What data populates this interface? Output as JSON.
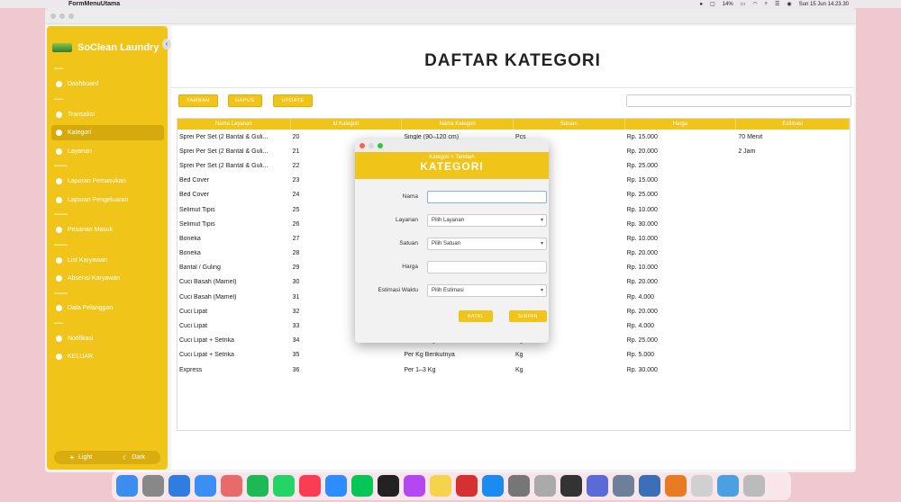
{
  "menubar": {
    "app_name": "FormMenuUtama",
    "battery": "14%",
    "datetime": "Sun 15 Jun  14.23.30"
  },
  "sidebar": {
    "brand": "SoClean Laundry",
    "items": [
      {
        "label": "Dashboard",
        "icon": "dashboard-icon"
      },
      {
        "label": "Transaksi",
        "icon": "transaction-icon"
      },
      {
        "label": "Kategori",
        "icon": "category-icon",
        "active": true
      },
      {
        "label": "Layanan",
        "icon": "service-icon"
      },
      {
        "label": "Laporan Pemasukan",
        "icon": "report-icon"
      },
      {
        "label": "Laporan Pengeluaran",
        "icon": "report-icon"
      },
      {
        "label": "Pesanan Masuk",
        "icon": "order-icon"
      },
      {
        "label": "List Karyawan",
        "icon": "list-icon"
      },
      {
        "label": "Absensi Karyawan",
        "icon": "attendance-icon"
      },
      {
        "label": "Data Pelanggan",
        "icon": "customer-icon"
      },
      {
        "label": "Notifikasi",
        "icon": "bell-icon"
      },
      {
        "label": "KELUAR",
        "icon": "logout-icon"
      }
    ],
    "theme": {
      "light": "Light",
      "dark": "Dark"
    }
  },
  "main": {
    "title": "DAFTAR KATEGORI",
    "buttons": {
      "add": "TAMBAH",
      "delete": "HAPUS",
      "update": "UPDATE"
    },
    "search_value": ""
  },
  "table": {
    "columns": [
      "Nama Layanan",
      "Id Kategori",
      "Nama Kategori",
      "Satuan",
      "Harga",
      "Estimasi"
    ],
    "rows": [
      [
        "Sprei Per Set (2 Bantal & Guli...",
        "20",
        "Single (90–120 cm)",
        "Pcs",
        "Rp. 15.000",
        "70 Menit"
      ],
      [
        "Sprei Per Set (2 Bantal & Guli...",
        "21",
        "",
        "",
        "Rp. 20.000",
        "2 Jam"
      ],
      [
        "Sprei Per Set (2 Bantal & Guli...",
        "22",
        "",
        "",
        "Rp. 25.000",
        ""
      ],
      [
        "Bed Cover",
        "23",
        "",
        "",
        "Rp. 15.000",
        ""
      ],
      [
        "Bed Cover",
        "24",
        "",
        "",
        "Rp. 25.000",
        ""
      ],
      [
        "Selimut Tipis",
        "25",
        "",
        "",
        "Rp. 10.000",
        ""
      ],
      [
        "Selimut Tipis",
        "26",
        "",
        "",
        "Rp. 30.000",
        ""
      ],
      [
        "Boneka",
        "27",
        "",
        "",
        "Rp. 10.000",
        ""
      ],
      [
        "Boneka",
        "28",
        "",
        "",
        "Rp. 20.000",
        ""
      ],
      [
        "Bantal / Guling",
        "29",
        "",
        "",
        "Rp. 10.000",
        ""
      ],
      [
        "Cuci Basah (Mamel)",
        "30",
        "",
        "",
        "Rp. 20.000",
        ""
      ],
      [
        "Cuci Basah (Mamel)",
        "31",
        "",
        "",
        "Rp. 4.000",
        ""
      ],
      [
        "Cuci Lipat",
        "32",
        "",
        "",
        "Rp. 20.000",
        ""
      ],
      [
        "Cuci Lipat",
        "33",
        "",
        "",
        "Rp. 4.000",
        ""
      ],
      [
        "Cuci Lipat + Setrika",
        "34",
        "Per 1–3 Kg",
        "Kg",
        "Rp. 25.000",
        ""
      ],
      [
        "Cuci Lipat + Setrika",
        "35",
        "Per Kg Berikutnya",
        "Kg",
        "Rp. 5.000",
        ""
      ],
      [
        "Express",
        "36",
        "Per 1–3 Kg",
        "Kg",
        "Rp. 30.000",
        ""
      ]
    ]
  },
  "dialog": {
    "breadcrumb": "Kategori > Tambah",
    "title": "KATEGORI",
    "fields": {
      "nama": {
        "label": "Nama",
        "value": ""
      },
      "layanan": {
        "label": "Layanan",
        "value": "Pilih Layanan"
      },
      "satuan": {
        "label": "Satuan",
        "value": "Pilih Satuan"
      },
      "harga": {
        "label": "Harga",
        "value": ""
      },
      "estimasi": {
        "label": "Estimasi Waktu",
        "value": "Pilih Estimasi"
      }
    },
    "buttons": {
      "cancel": "BATAL",
      "save": "SIMPAN"
    }
  },
  "dock": {
    "apps": [
      {
        "icon": "finder-icon",
        "color": "#3a8ef0"
      },
      {
        "icon": "launchpad-icon",
        "color": "#888888"
      },
      {
        "icon": "safari-icon",
        "color": "#2f7de1"
      },
      {
        "icon": "mail-icon",
        "color": "#3b8ef3"
      },
      {
        "icon": "photos-icon",
        "color": "#e96a6a"
      },
      {
        "icon": "spotify-icon",
        "color": "#1db954"
      },
      {
        "icon": "whatsapp-icon",
        "color": "#25d366"
      },
      {
        "icon": "music-icon",
        "color": "#fa3c55"
      },
      {
        "icon": "zoom-icon",
        "color": "#2d8cff"
      },
      {
        "icon": "line-icon",
        "color": "#06c755"
      },
      {
        "icon": "vn-icon",
        "color": "#222222"
      },
      {
        "icon": "picsart-icon",
        "color": "#b447f0"
      },
      {
        "icon": "notes-icon",
        "color": "#f5d34a"
      },
      {
        "icon": "photobooth-icon",
        "color": "#d63030"
      },
      {
        "icon": "appstore-icon",
        "color": "#1a8cf0"
      },
      {
        "icon": "settings-icon",
        "color": "#777777"
      },
      {
        "icon": "files-icon",
        "color": "#aaaaaa"
      },
      {
        "icon": "phone-icon",
        "color": "#333333"
      },
      {
        "icon": "app-icon",
        "color": "#5a6bd8"
      },
      {
        "icon": "dev-icon",
        "color": "#6e7f99"
      },
      {
        "icon": "preview-icon",
        "color": "#3b6fb5"
      },
      {
        "icon": "java-icon",
        "color": "#e87a22"
      },
      {
        "icon": "document-icon",
        "color": "#d0d0d0"
      },
      {
        "icon": "downloads-icon",
        "color": "#4aa0e0"
      },
      {
        "icon": "trash-icon",
        "color": "#bbbbbb"
      }
    ]
  }
}
